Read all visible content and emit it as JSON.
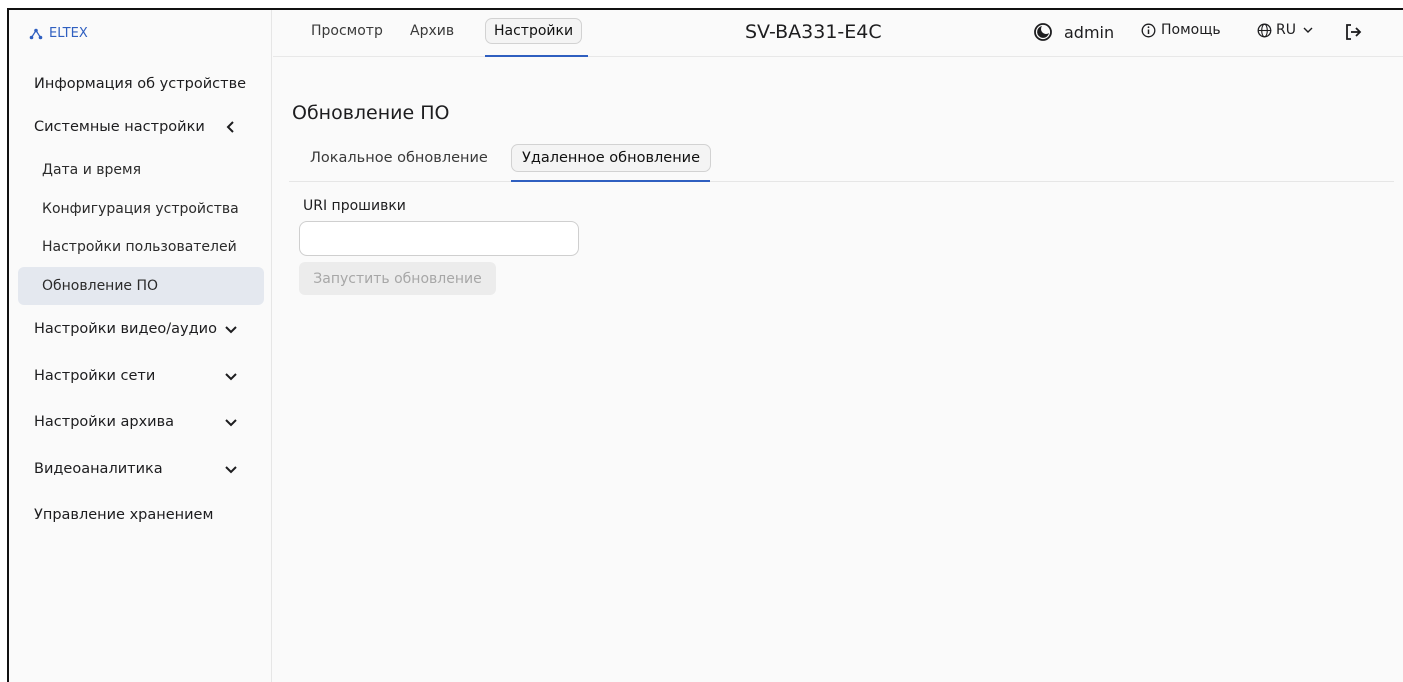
{
  "brand": {
    "logo_text": "ELTEX"
  },
  "header": {
    "tabs": [
      {
        "label": "Просмотр"
      },
      {
        "label": "Архив"
      },
      {
        "label": "Настройки"
      }
    ],
    "active_tab": "Настройки",
    "device_title": "SV-BA331-E4C",
    "user": "admin",
    "help_label": "Помощь",
    "language": "RU",
    "icons": {
      "theme": "moon-icon",
      "help": "info-icon",
      "language": "globe-icon",
      "logout": "logout-icon"
    }
  },
  "sidebar": {
    "items": [
      {
        "label": "Информация об устройстве"
      },
      {
        "label": "Системные настройки",
        "chevron": "left"
      },
      {
        "label": "Дата и время"
      },
      {
        "label": "Конфигурация устройства"
      },
      {
        "label": "Настройки пользователей"
      },
      {
        "label": "Обновление ПО",
        "active": true
      },
      {
        "label": "Настройки видео/аудио",
        "chevron": "down"
      },
      {
        "label": "Настройки сети",
        "chevron": "down"
      },
      {
        "label": "Настройки архива",
        "chevron": "down"
      },
      {
        "label": "Видеоаналитика",
        "chevron": "down"
      },
      {
        "label": "Управление хранением"
      }
    ]
  },
  "main": {
    "title": "Обновление ПО",
    "subtabs": [
      {
        "label": "Локальное обновление"
      },
      {
        "label": "Удаленное обновление",
        "active": true
      }
    ],
    "field_label": "URI прошивки",
    "uri_value": "",
    "run_button": "Запустить обновление"
  },
  "colors": {
    "accent": "#2f5fc0",
    "active_item_bg": "#e4e8ef",
    "disabled_text": "#a7a7a7"
  }
}
